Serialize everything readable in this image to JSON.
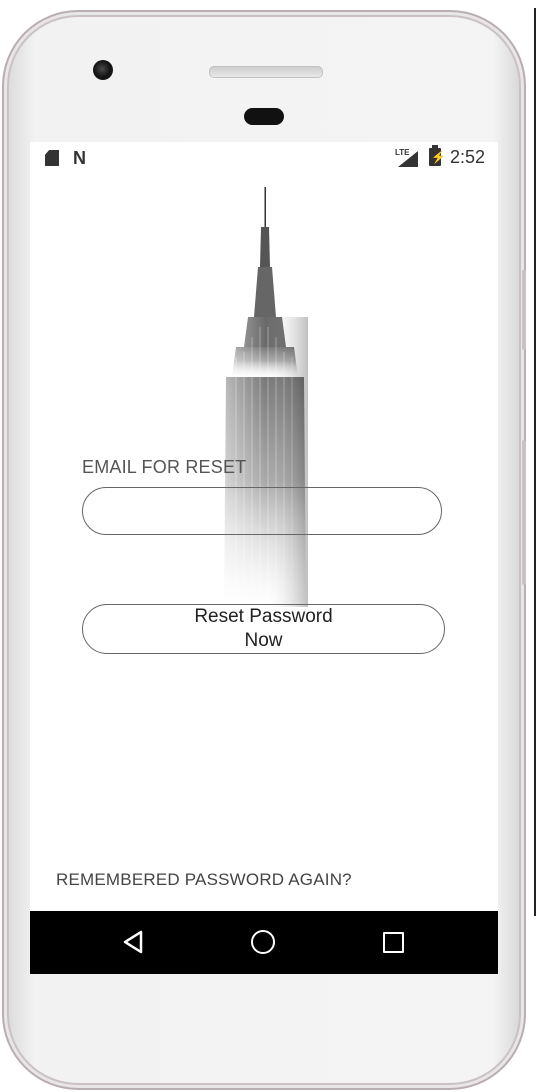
{
  "status_bar": {
    "network_label": "LTE",
    "time": "2:52"
  },
  "form": {
    "email_label": "EMAIL FOR RESET",
    "email_value": "",
    "reset_button_label": "Reset Password Now"
  },
  "footer": {
    "remembered_link": "REMEMBERED PASSWORD AGAIN?"
  },
  "icons": [
    "sd-card-icon",
    "n-notification-icon",
    "lte-signal-icon",
    "battery-charging-icon",
    "back-icon",
    "home-icon",
    "recents-icon"
  ],
  "colors": {
    "background": "#ffffff",
    "border": "#666666",
    "text": "#444444",
    "navbar": "#000000"
  }
}
